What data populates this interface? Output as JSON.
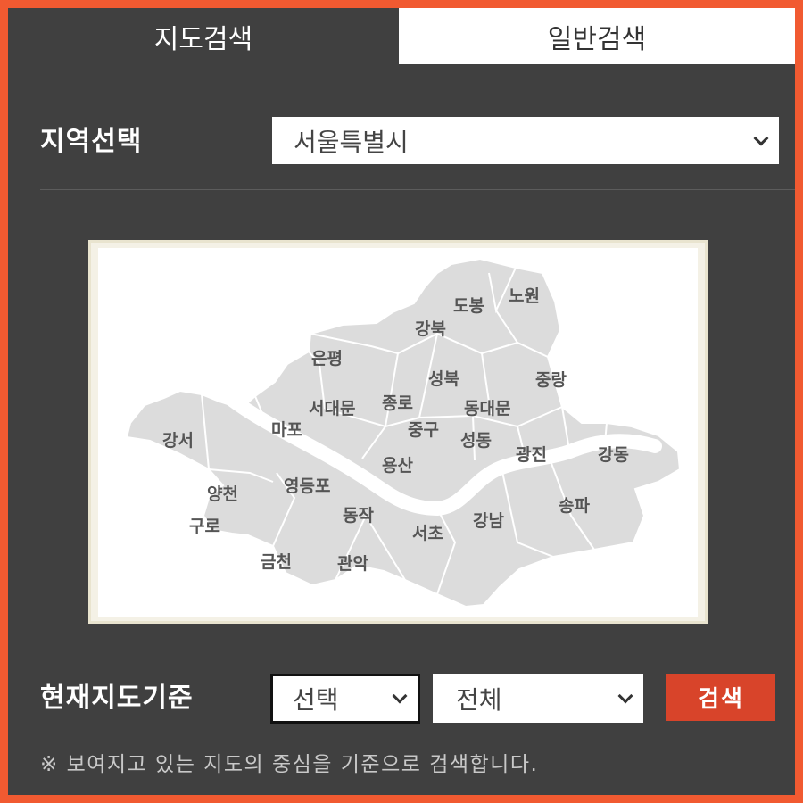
{
  "tabs": {
    "map_search": "지도검색",
    "general_search": "일반검색"
  },
  "region": {
    "label": "지역선택",
    "selected": "서울특별시"
  },
  "districts": [
    {
      "name": "도봉"
    },
    {
      "name": "노원"
    },
    {
      "name": "강북"
    },
    {
      "name": "은평"
    },
    {
      "name": "성북"
    },
    {
      "name": "중랑"
    },
    {
      "name": "서대문"
    },
    {
      "name": "종로"
    },
    {
      "name": "동대문"
    },
    {
      "name": "마포"
    },
    {
      "name": "중구"
    },
    {
      "name": "강서"
    },
    {
      "name": "성동"
    },
    {
      "name": "광진"
    },
    {
      "name": "강동"
    },
    {
      "name": "용산"
    },
    {
      "name": "양천"
    },
    {
      "name": "영등포"
    },
    {
      "name": "송파"
    },
    {
      "name": "동작"
    },
    {
      "name": "강남"
    },
    {
      "name": "구로"
    },
    {
      "name": "서초"
    },
    {
      "name": "금천"
    },
    {
      "name": "관악"
    }
  ],
  "current_map": {
    "label": "현재지도기준",
    "select1": "선택",
    "select2": "전체",
    "search_button": "검색"
  },
  "note": "※ 보여지고 있는 지도의 중심을 기준으로 검색합니다.",
  "colors": {
    "accent": "#f15a31",
    "panel": "#404040",
    "button": "#d8442a",
    "map_fill": "#dcdcdc"
  }
}
